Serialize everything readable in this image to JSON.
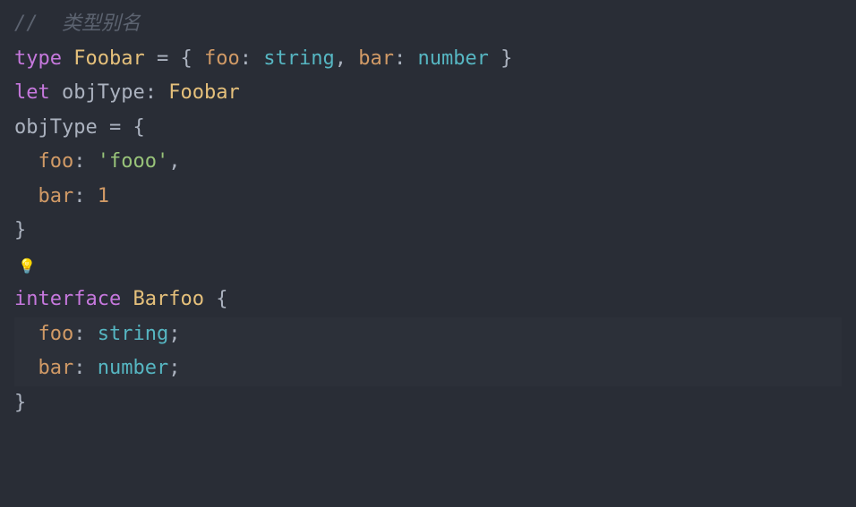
{
  "code": {
    "line1": {
      "comment_prefix": "//  ",
      "comment_text": "类型别名"
    },
    "line2": {
      "kw_type": "type",
      "sp1": " ",
      "type_name_a": "F",
      "type_name_b": "oobar",
      "sp2": " ",
      "eq": "=",
      "sp3": " ",
      "open": "{ ",
      "prop_foo": "foo",
      "colon1": ":",
      "sp4": " ",
      "t_string": "string",
      "comma1": ",",
      "sp5": " ",
      "prop_bar": "bar",
      "colon2": ":",
      "sp6": " ",
      "t_number": "number",
      "close": " }"
    },
    "line3": {
      "kw_let": "let",
      "sp1": " ",
      "var_name": "objType",
      "colon": ":",
      "sp2": " ",
      "type_ref": "Foobar"
    },
    "line4": {
      "var_name": "objType",
      "sp1": " ",
      "eq": "=",
      "sp2": " ",
      "open": "{"
    },
    "line5": {
      "indent": "  ",
      "prop": "foo",
      "colon": ":",
      "sp": " ",
      "val": "'fooo'",
      "comma": ","
    },
    "line6": {
      "indent": "  ",
      "prop": "bar",
      "colon": ":",
      "sp": " ",
      "val": "1"
    },
    "line7": {
      "close": "}"
    },
    "line8_bulb": "💡",
    "line9": {
      "kw_interface": "interface",
      "sp1": " ",
      "type_name": "Barfoo",
      "sp2": " ",
      "open": "{"
    },
    "line10": {
      "indent": "  ",
      "prop": "foo",
      "colon": ":",
      "sp": " ",
      "t": "string",
      "semi": ";"
    },
    "line11": {
      "indent": "  ",
      "prop": "bar",
      "colon": ":",
      "sp": " ",
      "t": "number",
      "semi": ";"
    },
    "line12": {
      "close": "}"
    }
  },
  "colors": {
    "background": "#292d36",
    "comment": "#5c6370",
    "keyword": "#c678dd",
    "typeName": "#e5c07b",
    "property": "#d19a66",
    "builtinType": "#56b6c2",
    "string": "#98c379",
    "number": "#d19a66",
    "default": "#abb2bf"
  }
}
